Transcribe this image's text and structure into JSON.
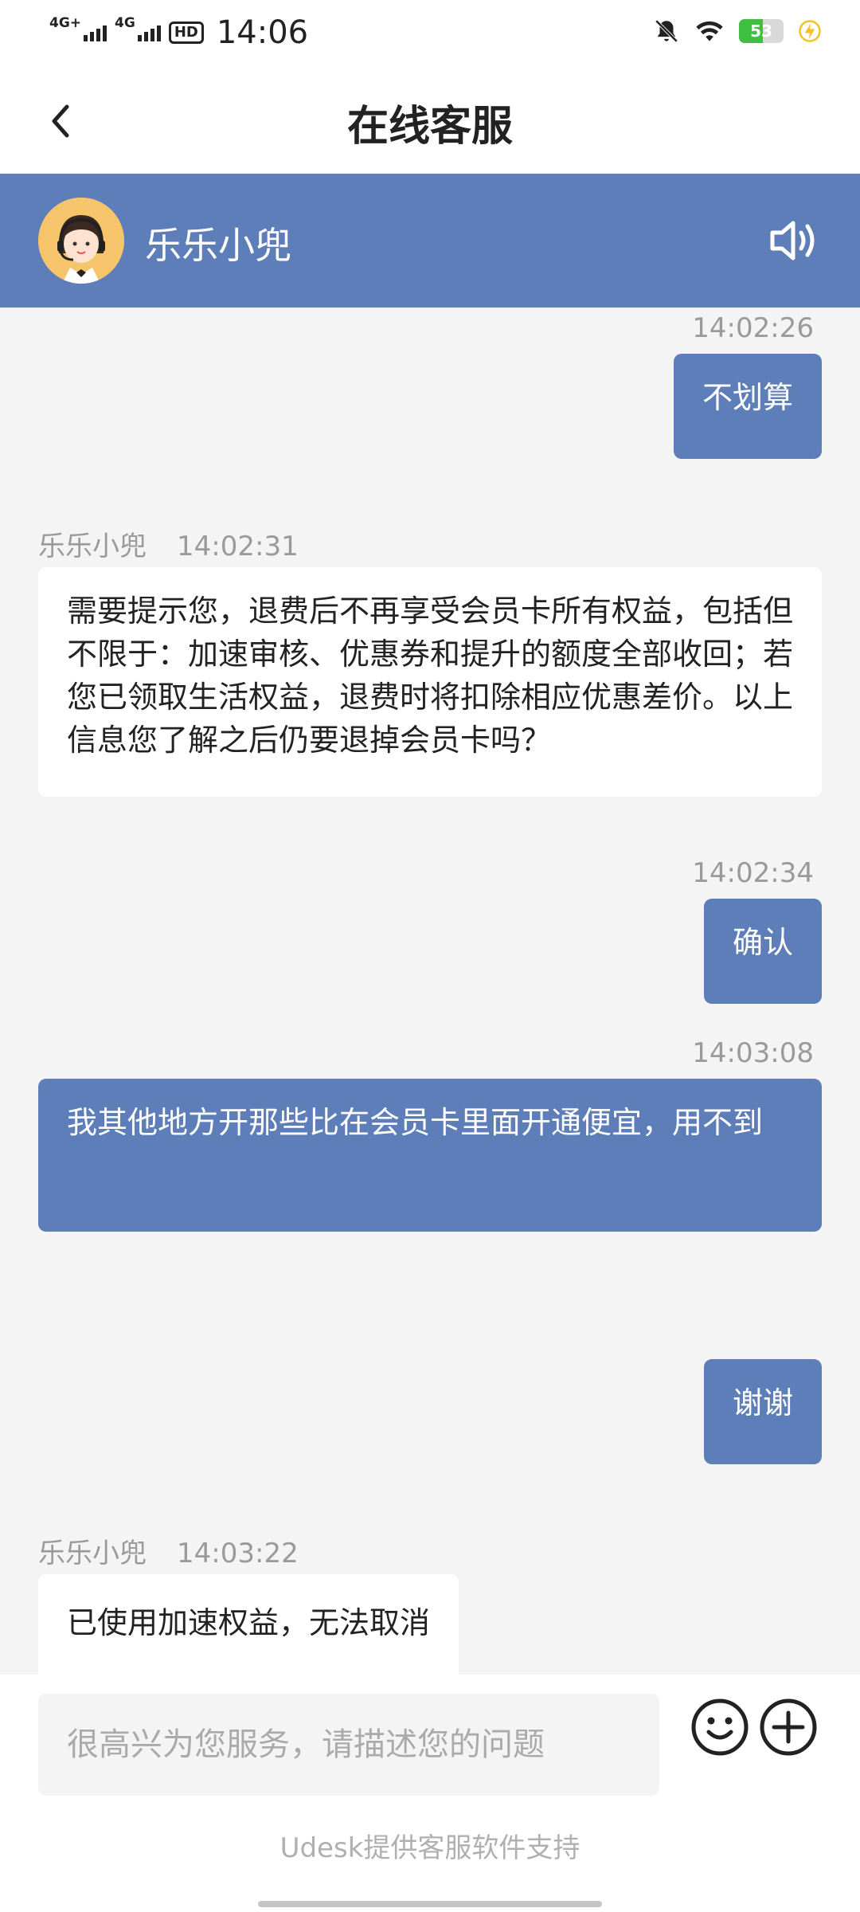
{
  "status_bar": {
    "network1": "4G+",
    "network2": "4G",
    "hd": "HD",
    "time": "14:06",
    "battery": "53",
    "battery_level": 0.53
  },
  "header": {
    "title": "在线客服"
  },
  "agent": {
    "name": "乐乐小兜"
  },
  "messages": [
    {
      "ts": "14:02:26",
      "text": "不划算"
    },
    {
      "sender": "乐乐小兜",
      "ts": "14:02:31",
      "text": "需要提示您，退费后不再享受会员卡所有权益，包括但不限于：加速审核、优惠券和提升的额度全部收回；若您已领取生活权益，退费时将扣除相应优惠差价。以上信息您了解之后仍要退掉会员卡吗？"
    },
    {
      "ts": "14:02:34",
      "text": "确认"
    },
    {
      "ts": "14:03:08",
      "text": "我其他地方开那些比在会员卡里面开通便宜，用不到"
    },
    {
      "text": "谢谢"
    },
    {
      "sender": "乐乐小兜",
      "ts": "14:03:22",
      "text": "已使用加速权益，无法取消"
    }
  ],
  "input": {
    "placeholder": "很高兴为您服务，请描述您的问题"
  },
  "footer": {
    "text": "Udesk提供客服软件支持"
  },
  "colors": {
    "accent": "#5e7eb9",
    "chat_bg": "#f4f4f4"
  },
  "icons": [
    "back-arrow-icon",
    "speaker-icon",
    "emoji-icon",
    "plus-icon",
    "mute-bell-icon",
    "wifi-icon",
    "charging-bolt-icon"
  ]
}
